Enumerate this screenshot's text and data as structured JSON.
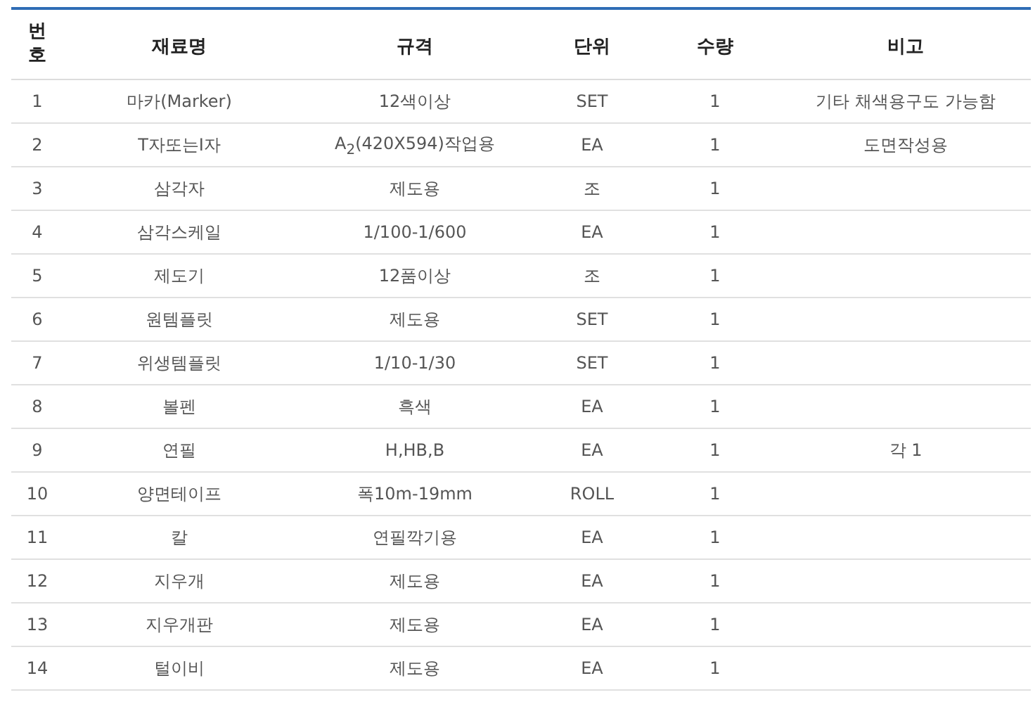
{
  "table": {
    "columns": [
      "번호",
      "재료명",
      "규격",
      "단위",
      "수량",
      "비고"
    ],
    "rows": [
      [
        "1",
        "마카(Marker)",
        "12색이상",
        "SET",
        "1",
        "기타 채색용구도 가능함"
      ],
      [
        "2",
        "T자또는I자",
        "A$_{2}$(420X594)작업용",
        "EA",
        "1",
        "도면작성용"
      ],
      [
        "3",
        "삼각자",
        "제도용",
        "조",
        "1",
        ""
      ],
      [
        "4",
        "삼각스케일",
        "1/100-1/600",
        "EA",
        "1",
        ""
      ],
      [
        "5",
        "제도기",
        "12품이상",
        "조",
        "1",
        ""
      ],
      [
        "6",
        "원템플릿",
        "제도용",
        "SET",
        "1",
        ""
      ],
      [
        "7",
        "위생템플릿",
        "1/10-1/30",
        "SET",
        "1",
        ""
      ],
      [
        "8",
        "볼펜",
        "흑색",
        "EA",
        "1",
        ""
      ],
      [
        "9",
        "연필",
        "H,HB,B",
        "EA",
        "1",
        "각 1"
      ],
      [
        "10",
        "양면테이프",
        "폭10m-19mm",
        "ROLL",
        "1",
        ""
      ],
      [
        "11",
        "칼",
        "연필깍기용",
        "EA",
        "1",
        ""
      ],
      [
        "12",
        "지우개",
        "제도용",
        "EA",
        "1",
        ""
      ],
      [
        "13",
        "지우개판",
        "제도용",
        "EA",
        "1",
        ""
      ],
      [
        "14",
        "털이비",
        "제도용",
        "EA",
        "1",
        ""
      ]
    ]
  }
}
